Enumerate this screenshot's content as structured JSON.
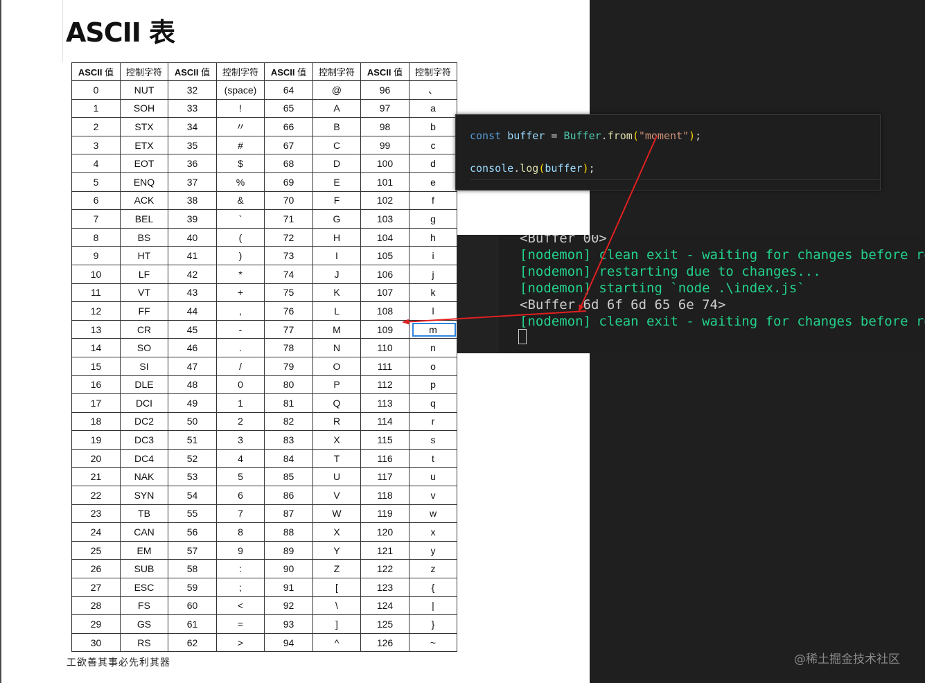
{
  "document": {
    "title": "ASCII 表",
    "footer": "工欲善其事必先利其器"
  },
  "ascii_table": {
    "headers": [
      {
        "label": "ASCII",
        "suffix": " 值"
      },
      {
        "label": "",
        "suffix": "控制字符"
      },
      {
        "label": "ASCII",
        "suffix": " 值"
      },
      {
        "label": "",
        "suffix": "控制字符"
      },
      {
        "label": "ASCII",
        "suffix": " 值"
      },
      {
        "label": "",
        "suffix": "控制字符"
      },
      {
        "label": "ASCII",
        "suffix": " 值"
      },
      {
        "label": "",
        "suffix": "控制字符"
      }
    ],
    "highlighted_cell": {
      "row": 13,
      "col": 7
    },
    "rows": [
      [
        "0",
        "NUT",
        "32",
        "(space)",
        "64",
        "@",
        "96",
        "、"
      ],
      [
        "1",
        "SOH",
        "33",
        "!",
        "65",
        "A",
        "97",
        "a"
      ],
      [
        "2",
        "STX",
        "34",
        "〃",
        "66",
        "B",
        "98",
        "b"
      ],
      [
        "3",
        "ETX",
        "35",
        "#",
        "67",
        "C",
        "99",
        "c"
      ],
      [
        "4",
        "EOT",
        "36",
        "$",
        "68",
        "D",
        "100",
        "d"
      ],
      [
        "5",
        "ENQ",
        "37",
        "%",
        "69",
        "E",
        "101",
        "e"
      ],
      [
        "6",
        "ACK",
        "38",
        "&",
        "70",
        "F",
        "102",
        "f"
      ],
      [
        "7",
        "BEL",
        "39",
        "`",
        "71",
        "G",
        "103",
        "g"
      ],
      [
        "8",
        "BS",
        "40",
        "(",
        "72",
        "H",
        "104",
        "h"
      ],
      [
        "9",
        "HT",
        "41",
        ")",
        "73",
        "I",
        "105",
        "i"
      ],
      [
        "10",
        "LF",
        "42",
        "*",
        "74",
        "J",
        "106",
        "j"
      ],
      [
        "11",
        "VT",
        "43",
        "+",
        "75",
        "K",
        "107",
        "k"
      ],
      [
        "12",
        "FF",
        "44",
        ",",
        "76",
        "L",
        "108",
        "l"
      ],
      [
        "13",
        "CR",
        "45",
        "-",
        "77",
        "M",
        "109",
        "m"
      ],
      [
        "14",
        "SO",
        "46",
        ".",
        "78",
        "N",
        "110",
        "n"
      ],
      [
        "15",
        "SI",
        "47",
        "/",
        "79",
        "O",
        "111",
        "o"
      ],
      [
        "16",
        "DLE",
        "48",
        "0",
        "80",
        "P",
        "112",
        "p"
      ],
      [
        "17",
        "DCI",
        "49",
        "1",
        "81",
        "Q",
        "113",
        "q"
      ],
      [
        "18",
        "DC2",
        "50",
        "2",
        "82",
        "R",
        "114",
        "r"
      ],
      [
        "19",
        "DC3",
        "51",
        "3",
        "83",
        "X",
        "115",
        "s"
      ],
      [
        "20",
        "DC4",
        "52",
        "4",
        "84",
        "T",
        "116",
        "t"
      ],
      [
        "21",
        "NAK",
        "53",
        "5",
        "85",
        "U",
        "117",
        "u"
      ],
      [
        "22",
        "SYN",
        "54",
        "6",
        "86",
        "V",
        "118",
        "v"
      ],
      [
        "23",
        "TB",
        "55",
        "7",
        "87",
        "W",
        "119",
        "w"
      ],
      [
        "24",
        "CAN",
        "56",
        "8",
        "88",
        "X",
        "120",
        "x"
      ],
      [
        "25",
        "EM",
        "57",
        "9",
        "89",
        "Y",
        "121",
        "y"
      ],
      [
        "26",
        "SUB",
        "58",
        ":",
        "90",
        "Z",
        "122",
        "z"
      ],
      [
        "27",
        "ESC",
        "59",
        ";",
        "91",
        "[",
        "123",
        "{"
      ],
      [
        "28",
        "FS",
        "60",
        "<",
        "92",
        "\\",
        "124",
        "|"
      ],
      [
        "29",
        "GS",
        "61",
        "=",
        "93",
        "]",
        "125",
        "}"
      ],
      [
        "30",
        "RS",
        "62",
        ">",
        "94",
        "^",
        "126",
        "~"
      ]
    ]
  },
  "code_editor": {
    "line1": {
      "kw": "const",
      "var": "buffer",
      "eq": " = ",
      "cls": "Buffer",
      "dot": ".",
      "fn": "from",
      "open": "(",
      "str": "\"moment\"",
      "close": ")",
      "semi": ";"
    },
    "line2": {
      "obj": "console",
      "dot": ".",
      "fn": "log",
      "open": "(",
      "arg": "buffer",
      "close": ")",
      "semi": ";"
    }
  },
  "terminal": {
    "lines": [
      "<Buffer 00>",
      "[nodemon] clean exit - waiting for changes before restart",
      "[nodemon] restarting due to changes...",
      "[nodemon] starting `node .\\index.js`",
      "<Buffer 6d 6f 6d 65 6e 74>",
      "[nodemon] clean exit - waiting for changes before restart"
    ]
  },
  "colors": {
    "annotation_arrow": "#e02020",
    "terminal_green": "#23d18b",
    "highlight_box": "#2e86de"
  },
  "watermark": "@稀土掘金技术社区"
}
